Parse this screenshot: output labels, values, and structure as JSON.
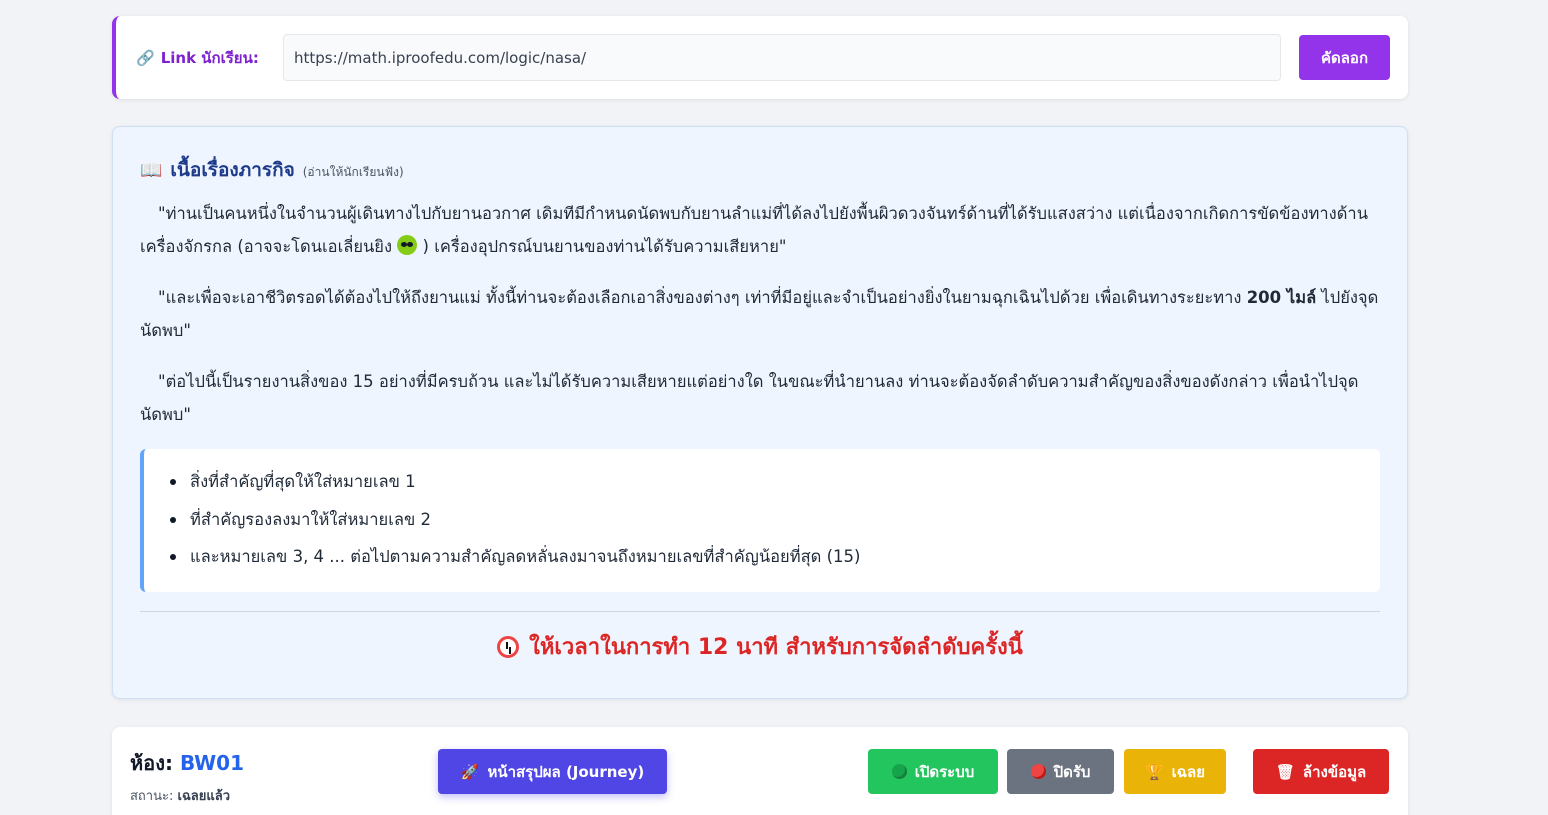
{
  "link": {
    "label": "Link นักเรียน:",
    "url": "https://math.iproofedu.com/logic/nasa/",
    "copy_label": "คัดลอก"
  },
  "mission": {
    "title": "เนื้อเรื่องภารกิจ",
    "subtitle": "(อ่านให้นักเรียนฟัง)",
    "p1_a": "\"ท่านเป็นคนหนึ่งในจำนวนผู้เดินทางไปกับยานอวกาศ เดิมทีมีกำหนดนัดพบกับยานลำแม่ที่ได้ลงไปยังพื้นผิวดวงจันทร์ด้านที่ได้รับแสงสว่าง แต่เนื่องจากเกิดการขัดข้องทางด้านเครื่องจักรกล (อาจจะโดนเอเลี่ยนยิง ",
    "p1_b": " ) เครื่องอุปกรณ์บนยานของท่านได้รับความเสียหาย\"",
    "p2_a": "\"และเพื่อจะเอาชีวิตรอดได้ต้องไปให้ถึงยานแม่ ทั้งนี้ท่านจะต้องเลือกเอาสิ่งของต่างๆ เท่าที่มีอยู่และจำเป็นอย่างยิ่งในยามฉุกเฉินไปด้วย เพื่อเดินทางระยะทาง ",
    "p2_bold": "200 ไมล์",
    "p2_b": " ไปยังจุดนัดพบ\"",
    "p3": "\"ต่อไปนี้เป็นรายงานสิ่งของ 15 อย่างที่มีครบถ้วน และไม่ได้รับความเสียหายแต่อย่างใด ในขณะที่นำยานลง ท่านจะต้องจัดลำดับความสำคัญของสิ่งของดังกล่าว เพื่อนำไปจุดนัดพบ\"",
    "rules": [
      "สิ่งที่สำคัญที่สุดให้ใส่หมายเลข 1",
      "ที่สำคัญรองลงมาให้ใส่หมายเลข 2",
      "และหมายเลข 3, 4 ... ต่อไปตามความสำคัญลดหลั่นลงมาจนถึงหมายเลขที่สำคัญน้อยที่สุด (15)"
    ],
    "time_note": "ให้เวลาในการทำ 12 นาที สำหรับการจัดลำดับครั้งนี้"
  },
  "room": {
    "label": "ห้อง:",
    "code": "BW01",
    "status_label": "สถานะ:",
    "status_value": "เฉลยแล้ว"
  },
  "buttons": {
    "journey": "หน้าสรุปผล (Journey)",
    "open": "เปิดระบบ",
    "close": "ปิดรับ",
    "answer": "เฉลย",
    "clear": "ล้างข้อมูล"
  },
  "colors": {
    "accent_purple": "#9333ea",
    "indigo": "#4f46e5",
    "green": "#22c55e",
    "gray": "#6b7280",
    "yellow": "#eab308",
    "red": "#dc2626",
    "title_blue": "#1e3a8a"
  },
  "icons": {
    "link": "link-icon",
    "mission": "book-icon",
    "time": "alarm-clock-icon",
    "journey": "rocket-icon",
    "open": "green-circle-icon",
    "close": "red-circle-icon",
    "answer": "trophy-icon",
    "clear": "trash-icon"
  }
}
